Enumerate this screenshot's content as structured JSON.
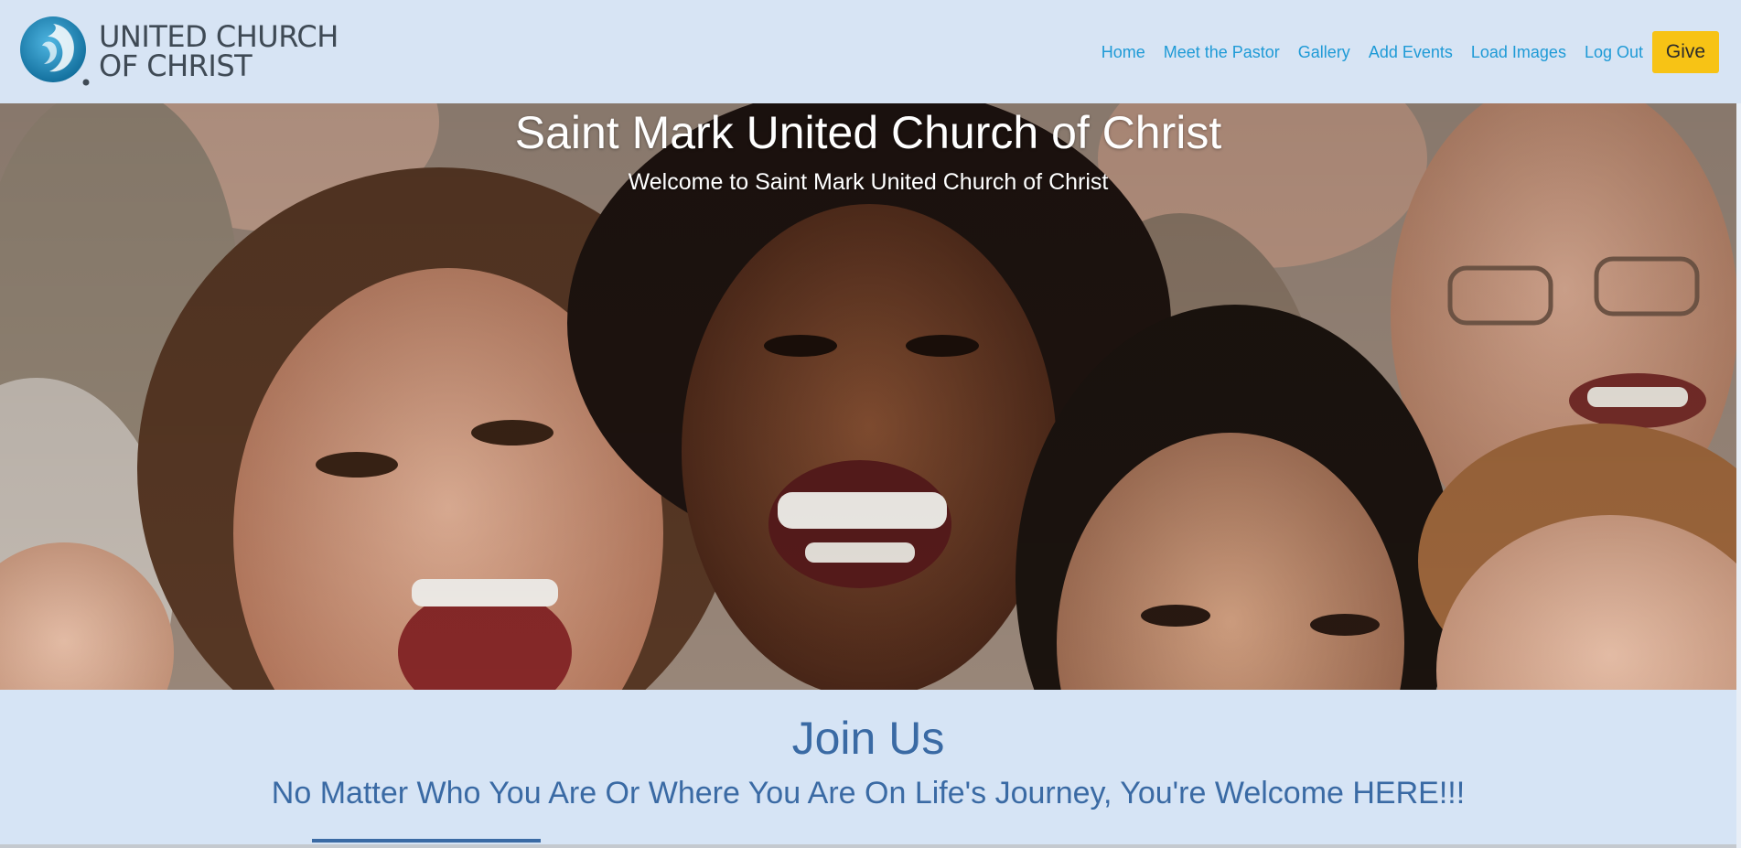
{
  "brand": {
    "line1": "UNITED CHURCH",
    "line2": "OF CHRIST",
    "logo_icon": "ucc-comma-logo-icon",
    "logo_color": "#1e8fc2"
  },
  "nav": {
    "items": [
      {
        "label": "Home"
      },
      {
        "label": "Meet the Pastor"
      },
      {
        "label": "Gallery"
      },
      {
        "label": "Add Events"
      },
      {
        "label": "Load Images"
      },
      {
        "label": "Log Out"
      }
    ],
    "give_label": "Give",
    "link_color": "#1e9ad6",
    "give_color": "#f7c315"
  },
  "hero": {
    "title": "Saint Mark United Church of Christ",
    "subtitle": "Welcome to Saint Mark United Church of Christ"
  },
  "join": {
    "heading": "Join Us",
    "tagline": "No Matter Who You Are Or Where You Are On Life's Journey, You're Welcome HERE!!!",
    "accent_color": "#3a6aa4"
  }
}
